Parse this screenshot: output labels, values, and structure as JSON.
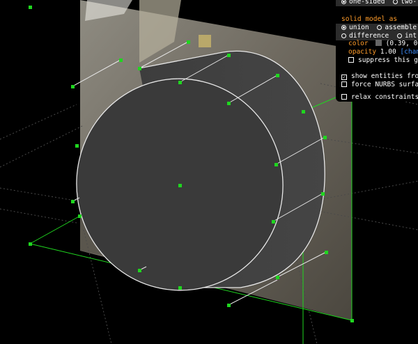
{
  "panel": {
    "row0_a": "one-sided",
    "row0_b": "two-",
    "heading": "solid model as",
    "opt_union": "union",
    "opt_assemble": "assemble",
    "opt_difference": "difference",
    "opt_int": "int",
    "color_label": "color",
    "color_value": "(0.39, 0",
    "color_link": "[chang",
    "opacity_label": "opacity",
    "opacity_value": "1.00",
    "opacity_link": "[chang",
    "suppress": "suppress this gr",
    "show_entities": "show entities from",
    "force_nurbs": "force NURBS surfac",
    "relax": "relax constraints"
  },
  "colors": {
    "swatch": "#666666",
    "accent_green": "#1fd61f",
    "solid_fill": "#3a3a3a"
  }
}
